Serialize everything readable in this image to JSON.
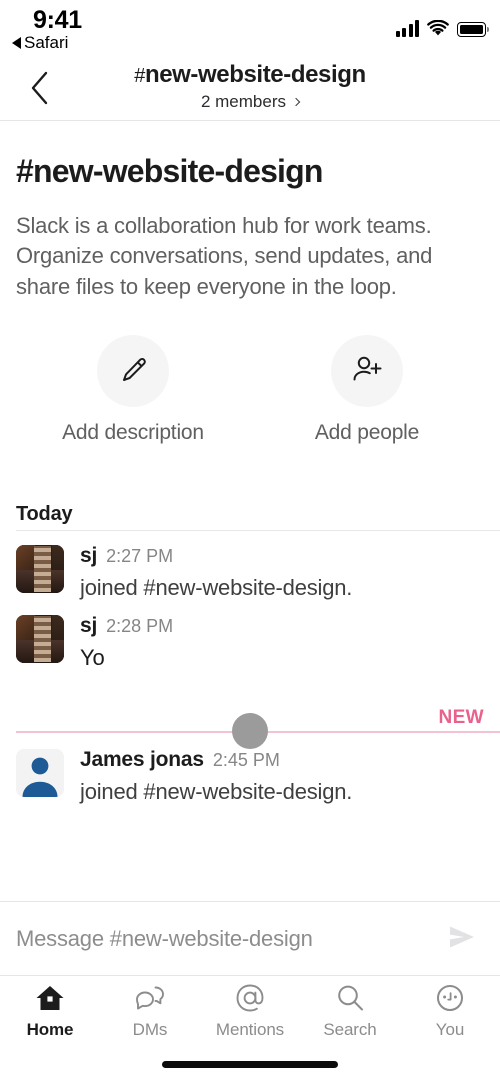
{
  "status_bar": {
    "time": "9:41",
    "back_app": "Safari",
    "back_triangle_icon": "triangle-left-icon",
    "signal_icon": "cellular-signal-icon",
    "wifi_icon": "wifi-icon",
    "battery_icon": "battery-full-icon"
  },
  "navbar": {
    "back_icon": "chevron-left-icon",
    "hash": "#",
    "title": "new-website-design",
    "members": "2 members",
    "members_chevron_icon": "chevron-right-icon"
  },
  "channel": {
    "title": "#new-website-design",
    "description": "Slack is a collaboration hub for work teams. Organize conversations, send updates, and share files to keep everyone in the loop."
  },
  "actions": [
    {
      "label": "Add description",
      "icon": "pencil-icon"
    },
    {
      "label": "Add people",
      "icon": "add-person-icon"
    }
  ],
  "day_divider": {
    "label": "Today"
  },
  "messages": [
    {
      "author": "sj",
      "time": "2:27 PM",
      "text": "joined #new-website-design.",
      "avatar": "photo-avatar",
      "system": true
    },
    {
      "author": "sj",
      "time": "2:28 PM",
      "text": "Yo",
      "avatar": "photo-avatar",
      "system": false
    },
    {
      "author": "James jonas",
      "time": "2:45 PM",
      "text": "joined #new-website-design.",
      "avatar": "default-person-avatar",
      "system": true
    }
  ],
  "new_divider": {
    "label": "NEW",
    "color": "#e8628c",
    "line_color": "#f2c4d2",
    "dot_color": "#9b9b9b"
  },
  "composer": {
    "placeholder": "Message #new-website-design",
    "value": "",
    "send_icon": "send-paper-plane-icon"
  },
  "tabbar": {
    "items": [
      {
        "label": "Home",
        "icon": "home-icon",
        "active": true
      },
      {
        "label": "DMs",
        "icon": "speech-bubbles-icon",
        "active": false
      },
      {
        "label": "Mentions",
        "icon": "at-sign-icon",
        "active": false
      },
      {
        "label": "Search",
        "icon": "magnifier-icon",
        "active": false
      },
      {
        "label": "You",
        "icon": "face-circle-icon",
        "active": false
      }
    ]
  }
}
